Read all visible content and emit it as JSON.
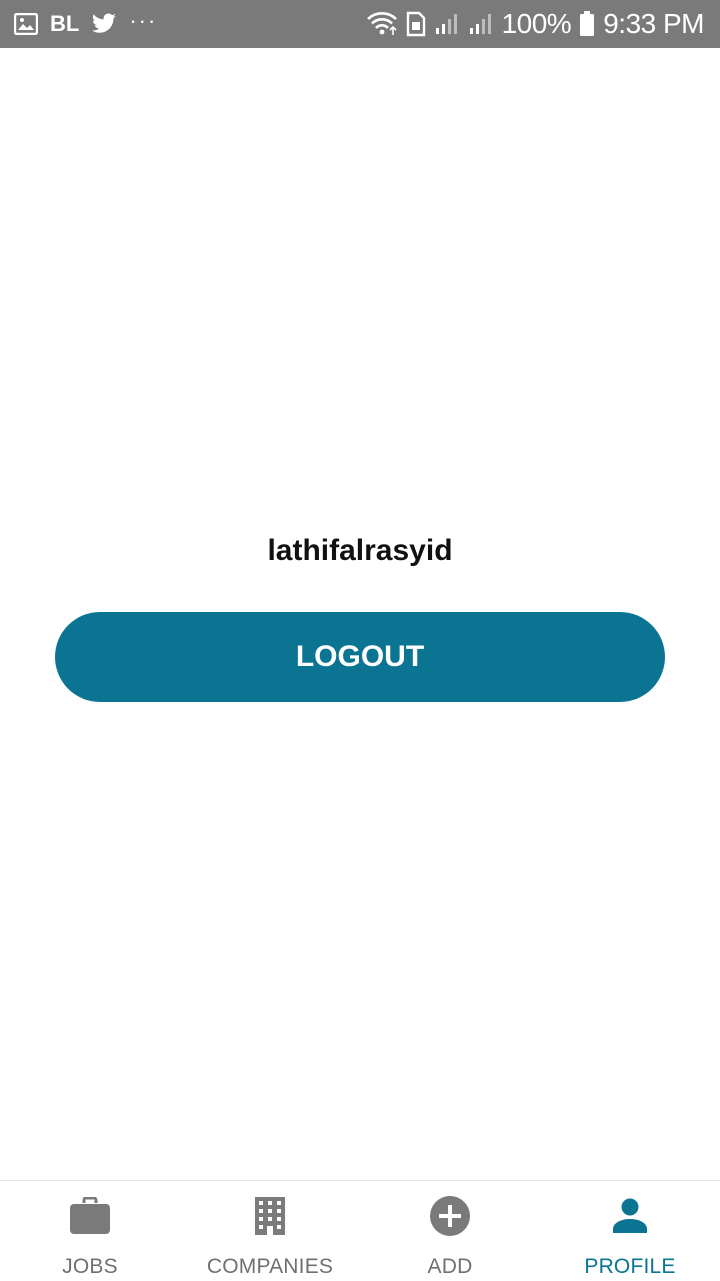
{
  "status_bar": {
    "left_app_label": "BL",
    "dots": "···",
    "battery": "100%",
    "time": "9:33 PM",
    "icons": [
      "image-icon",
      "bl-icon",
      "twitter-icon",
      "more-dots-icon",
      "wifi-icon",
      "sim-icon",
      "signal-icon",
      "signal-icon",
      "battery-icon"
    ]
  },
  "profile": {
    "username": "lathifalrasyid",
    "logout_label": "LOGOUT"
  },
  "bottom_nav": {
    "items": [
      {
        "label": "JOBS",
        "icon": "briefcase-icon",
        "active": false
      },
      {
        "label": "COMPANIES",
        "icon": "building-icon",
        "active": false
      },
      {
        "label": "ADD",
        "icon": "add-circle-icon",
        "active": false
      },
      {
        "label": "PROFILE",
        "icon": "person-icon",
        "active": true
      }
    ]
  },
  "colors": {
    "accent": "#0a7492",
    "status_bar": "#7a7a7a",
    "inactive": "#707070"
  }
}
